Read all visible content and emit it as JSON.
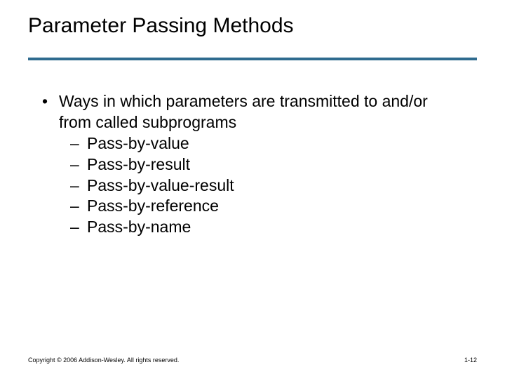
{
  "title": "Parameter Passing Methods",
  "main_bullet": "Ways in which parameters are transmitted to and/or from called subprograms",
  "sub_bullets": [
    "Pass-by-value",
    "Pass-by-result",
    "Pass-by-value-result",
    "Pass-by-reference",
    "Pass-by-name"
  ],
  "footer": {
    "copyright": "Copyright © 2006 Addison-Wesley. All rights reserved.",
    "page": "1-12"
  }
}
